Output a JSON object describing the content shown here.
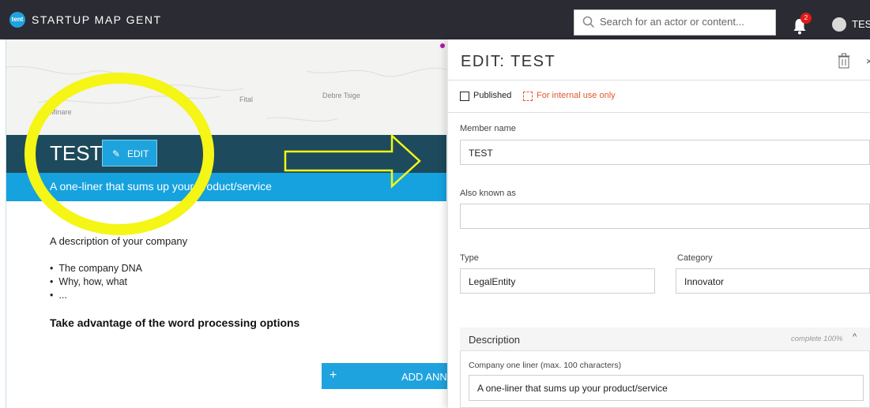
{
  "topbar": {
    "logo_text": "tent",
    "app_title": "STARTUP MAP GENT",
    "search_placeholder": "Search for an actor or content...",
    "notification_count": "2",
    "user_name": "TES"
  },
  "map": {
    "labels": [
      "Minare",
      "Fital",
      "Debre Tsige"
    ]
  },
  "member": {
    "name": "TEST",
    "edit_label": "EDIT",
    "oneliner": "A one-liner that sums up your product/service",
    "description_intro": "A description of your company",
    "bullets": [
      "The company DNA",
      "Why, how, what",
      "..."
    ],
    "advantage_heading": "Take advantage of the word processing options",
    "add_annotation_label": "ADD ANNO"
  },
  "panel": {
    "title": "EDIT: TEST",
    "published_label": "Published",
    "internal_label": "For internal use only",
    "member_name_label": "Member name",
    "member_name_value": "TEST",
    "aka_label": "Also known as",
    "aka_value": "",
    "type_label": "Type",
    "type_value": "LegalEntity",
    "category_label": "Category",
    "category_value": "Innovator",
    "description_section": "Description",
    "completeness": "complete 100%",
    "oneliner_label": "Company one liner (max. 100 characters)",
    "oneliner_value": "A one-liner that sums up your product/service"
  },
  "colors": {
    "topbar": "#2b2b33",
    "accent_blue": "#1fa3de",
    "header_dark": "#1d4a5c",
    "highlight_yellow": "#f5f516",
    "internal_orange": "#e2572b"
  }
}
